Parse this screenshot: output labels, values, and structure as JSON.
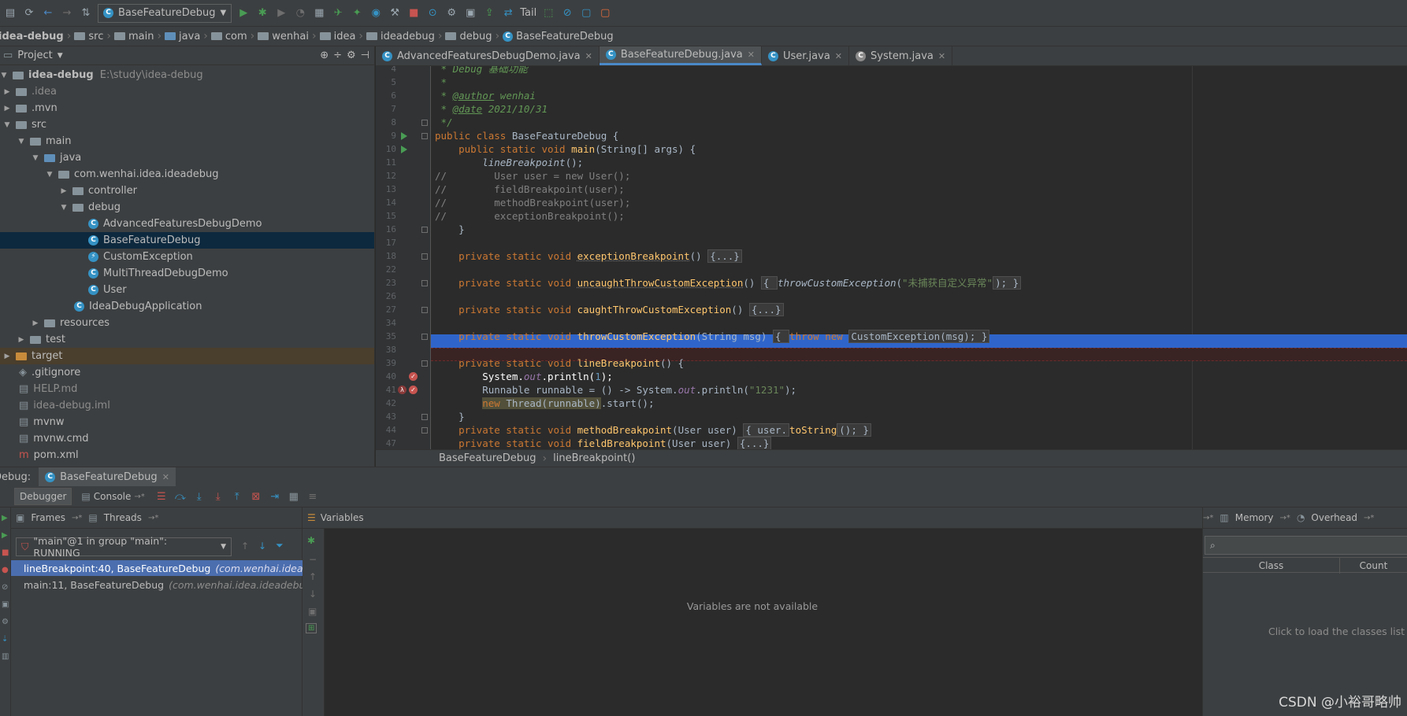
{
  "toolbar": {
    "run_config": "BaseFeatureDebug",
    "tail_label": "Tail"
  },
  "navbar": {
    "crumbs": [
      "idea-debug",
      "src",
      "main",
      "java",
      "com",
      "wenhai",
      "idea",
      "ideadebug",
      "debug",
      "BaseFeatureDebug"
    ]
  },
  "project": {
    "header": "Project",
    "root_name": "idea-debug",
    "root_path": "E:\\study\\idea-debug",
    "items": [
      ".idea",
      ".mvn",
      "src",
      "main",
      "java",
      "com.wenhai.idea.ideadebug",
      "controller",
      "debug",
      "AdvancedFeaturesDebugDemo",
      "BaseFeatureDebug",
      "CustomException",
      "MultiThreadDebugDemo",
      "User",
      "IdeaDebugApplication",
      "resources",
      "test",
      "target",
      ".gitignore",
      "HELP.md",
      "idea-debug.iml",
      "mvnw",
      "mvnw.cmd",
      "pom.xml"
    ]
  },
  "editor": {
    "tabs": [
      "AdvancedFeaturesDebugDemo.java",
      "BaseFeatureDebug.java",
      "User.java",
      "System.java"
    ],
    "line_numbers": [
      "4",
      "5",
      "6",
      "7",
      "8",
      "9",
      "10",
      "11",
      "12",
      "13",
      "14",
      "15",
      "16",
      "17",
      "18",
      "22",
      "23",
      "26",
      "27",
      "34",
      "35",
      "38",
      "39",
      "40",
      "41",
      "42",
      "43",
      "44",
      "47"
    ],
    "breadcrumb": [
      "BaseFeatureDebug",
      "lineBreakpoint()"
    ],
    "code": {
      "l4_a": " * ",
      "l4_b": "Debug",
      "l4_c": " 基础功能",
      "l5": " *",
      "l6_a": " * ",
      "l6_b": "@author",
      "l6_c": " wenhai",
      "l7_a": " * ",
      "l7_b": "@date",
      "l7_c": " 2021/10/31",
      "l8": " */",
      "l9_a": "public class ",
      "l9_b": "BaseFeatureDebug {",
      "l10_a": "    public static void ",
      "l10_b": "main",
      "l10_c": "(String[] args) {",
      "l11_a": "        ",
      "l11_b": "lineBreakpoint",
      "l11_c": "();",
      "l12": "//        User user = new User();",
      "l13": "//        fieldBreakpoint(user);",
      "l14": "//        methodBreakpoint(user);",
      "l15": "//        exceptionBreakpoint();",
      "l16": "    }",
      "l18_a": "    private static void ",
      "l18_b": "exceptionBreakpoint",
      "l18_c": "() ",
      "l18_d": "{...}",
      "l23_a": "    private static void ",
      "l23_b": "uncaughtThrowCustomException",
      "l23_c": "() ",
      "l23_d": "{ ",
      "l23_e": "throwCustomException",
      "l23_f": "(",
      "l23_g": "\"未捕获自定义异常\"",
      "l23_h": "); }",
      "l27_a": "    private static void ",
      "l27_b": "caughtThrowCustomException",
      "l27_c": "() ",
      "l27_d": "{...}",
      "l35_a": "    private static void ",
      "l35_b": "throwCustomException",
      "l35_c": "(String msg) ",
      "l35_d": "{ ",
      "l35_e": "throw new ",
      "l35_f": "CustomException(msg); }",
      "l39_a": "    private static void ",
      "l39_b": "lineBreakpoint",
      "l39_c": "() {",
      "l40_a": "        System.",
      "l40_b": "out",
      "l40_c": ".println(",
      "l40_d": "1",
      "l40_e": ");",
      "l41_a": "        Runnable runnable = () -> System.",
      "l41_b": "out",
      "l41_c": ".println(",
      "l41_d": "\"1231\"",
      "l41_e": ");",
      "l42_a": "        ",
      "l42_b": "new ",
      "l42_c": "Thread(runnable)",
      "l42_d": ".start();",
      "l43": "    }",
      "l44_a": "    private static void ",
      "l44_b": "methodBreakpoint",
      "l44_c": "(User user) ",
      "l44_d": "{ user.",
      "l44_e": "toString",
      "l44_f": "(); }",
      "l47_a": "    private static void ",
      "l47_b": "fieldBreakpoint",
      "l47_c": "(User user) ",
      "l47_d": "{...}"
    }
  },
  "debug": {
    "title": "Debug:",
    "session_tab": "BaseFeatureDebug",
    "debugger_tab": "Debugger",
    "console_tab": "Console",
    "frames_label": "Frames",
    "threads_label": "Threads",
    "thread_selected": "\"main\"@1 in group \"main\": RUNNING",
    "frames": [
      {
        "method": "lineBreakpoint:40, BaseFeatureDebug",
        "pkg": "(com.wenhai.idea.idea"
      },
      {
        "method": "main:11, BaseFeatureDebug",
        "pkg": "(com.wenhai.idea.ideadebug.de"
      }
    ],
    "variables_label": "Variables",
    "variables_empty": "Variables are not available",
    "memory_label": "Memory",
    "overhead_label": "Overhead",
    "class_col": "Class",
    "count_col": "Count",
    "memory_hint": "Click to load the classes list"
  },
  "watermark": "CSDN @小裕哥略帅",
  "colors": {
    "accent": "#4a88c7",
    "selection": "#2f65ca",
    "breakpoint": "#c75450",
    "run_green": "#499c54"
  }
}
